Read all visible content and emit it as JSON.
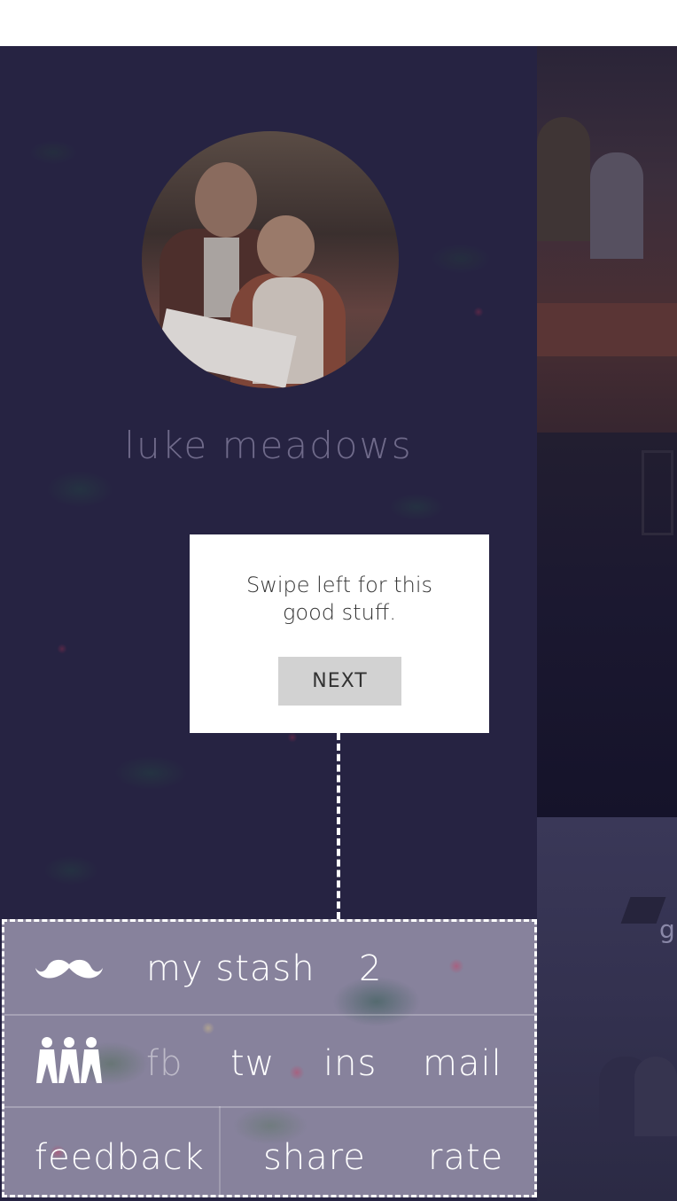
{
  "profile": {
    "name": "luke meadows"
  },
  "side_photos": {
    "edge_letter": "g"
  },
  "dialog": {
    "message": "Swipe left for this good stuff.",
    "next_label": "NEXT"
  },
  "menu": {
    "stash_icon": "mustache-icon",
    "stash_label": "my stash",
    "stash_count": "2",
    "friends_icon": "people-icon",
    "share_links": [
      {
        "label": "fb",
        "enabled": false
      },
      {
        "label": "tw",
        "enabled": true
      },
      {
        "label": "ins",
        "enabled": true
      },
      {
        "label": "mail",
        "enabled": true
      }
    ],
    "feedback_label": "feedback",
    "share_label": "share",
    "rate_label": "rate"
  },
  "colors": {
    "overlay": "#2c2846",
    "dialog_bg": "#ffffff",
    "button_bg": "#d2d2d2",
    "menu_text": "#ffffff"
  }
}
